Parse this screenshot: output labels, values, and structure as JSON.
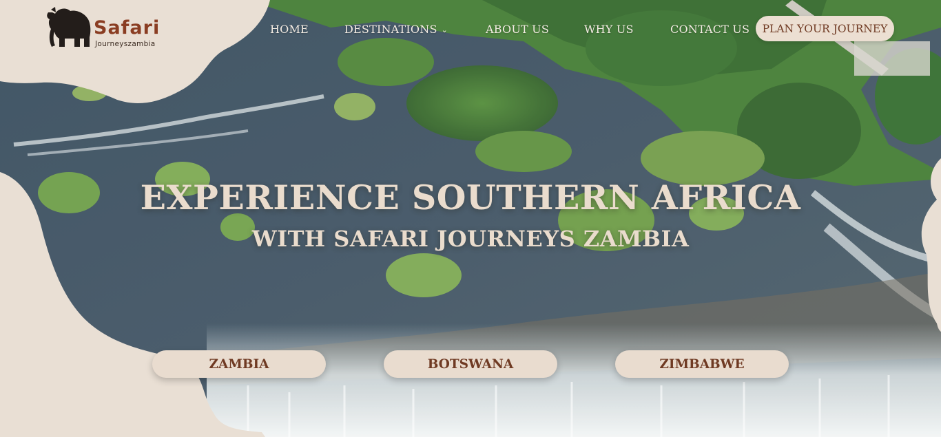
{
  "brand": {
    "name": "Safari",
    "tagline": "Journeyszambia",
    "logo_icon": "elephant-icon"
  },
  "nav": {
    "home": "HOME",
    "destinations": "DESTINATIONS",
    "destinations_icon": "chevron-down-icon",
    "about": "ABOUT US",
    "why": "WHY US",
    "contact": "CONTACT US",
    "plan": "PLAN YOUR JOURNEY"
  },
  "hero": {
    "title": "EXPERIENCE SOUTHERN AFRICA",
    "subtitle": "WITH SAFARI JOURNEYS ZAMBIA"
  },
  "destinations": {
    "zambia": "ZAMBIA",
    "botswana": "BOTSWANA",
    "zimbabwe": "ZIMBABWE"
  },
  "colors": {
    "cream": "#e9dfd4",
    "brand_brown": "#8a3d22",
    "button_text": "#6f3a23",
    "heading_text": "#eadccd"
  }
}
